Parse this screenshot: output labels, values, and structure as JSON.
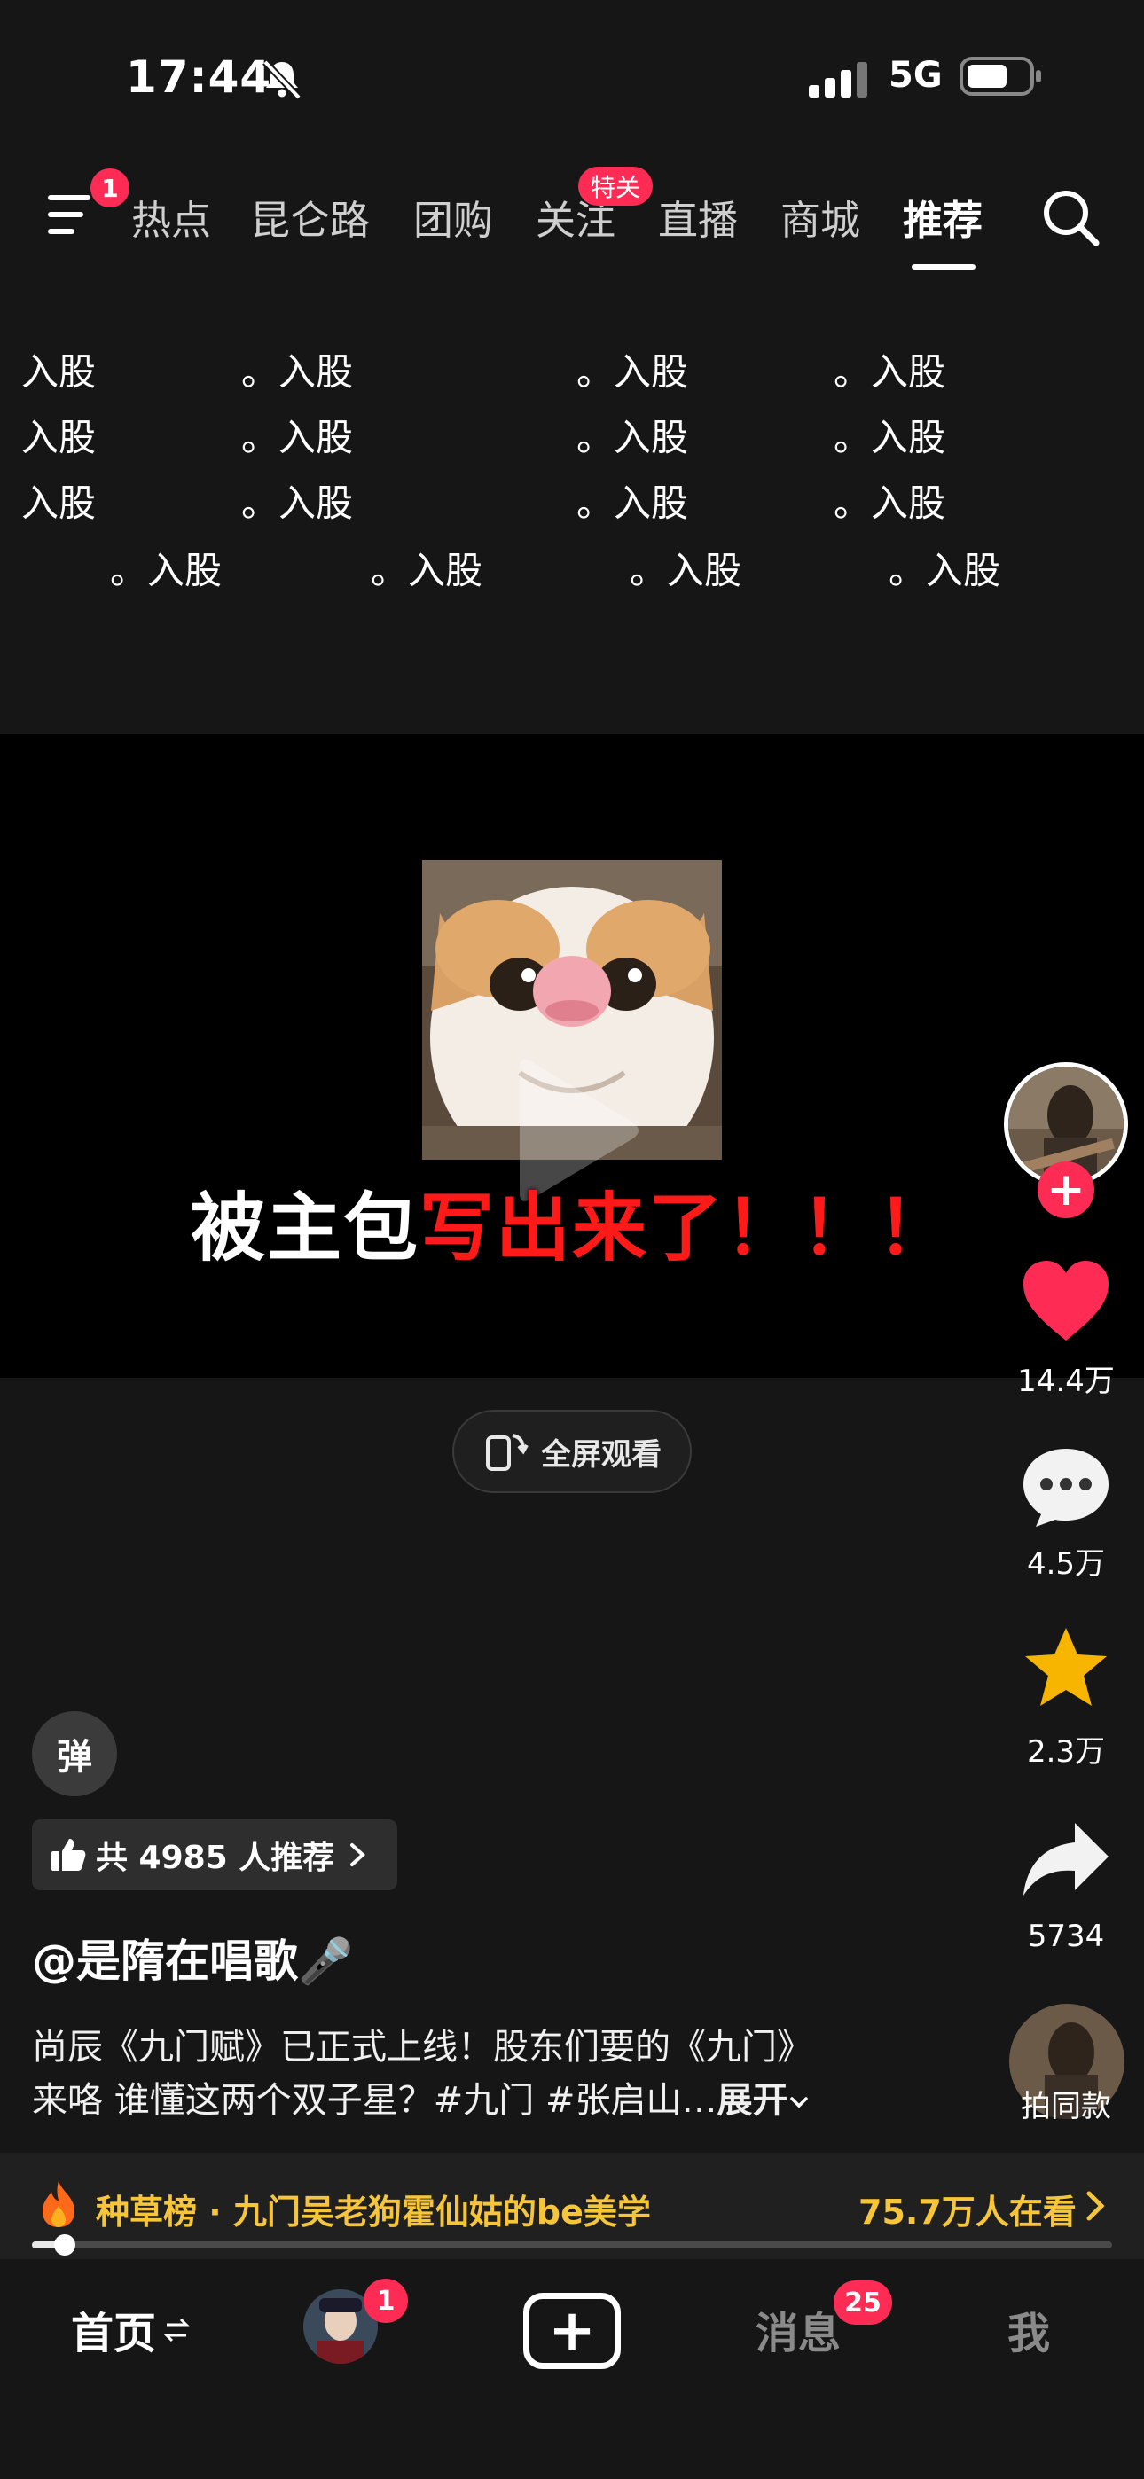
{
  "status_bar": {
    "time": "17:44",
    "network": "5G"
  },
  "top_nav": {
    "menu_badge": "1",
    "tabs": [
      {
        "label": "热点"
      },
      {
        "label": "昆仑路"
      },
      {
        "label": "团购"
      },
      {
        "label": "关注",
        "badge": "特关"
      },
      {
        "label": "直播"
      },
      {
        "label": "商城"
      },
      {
        "label": "推荐",
        "active": true
      }
    ]
  },
  "danmaku": {
    "text": "入股",
    "dotted_text": "。入股"
  },
  "video": {
    "caption_white": "被主包",
    "caption_red": "写出来了！！！",
    "fullscreen_label": "全屏观看"
  },
  "rail": {
    "likes": "14.4万",
    "comments": "4.5万",
    "favorites": "2.3万",
    "shares": "5734",
    "same_label": "拍同款"
  },
  "post": {
    "danmaku_toggle": "弹",
    "recommend_text": "共 4985 人推荐",
    "author": "@是隋在唱歌🎤",
    "desc_line1": "尚辰《九门赋》已正式上线！股东们要的《九门》",
    "desc_line2": "来咯 谁懂这两个双子星？#九门 #张启山…",
    "expand": "展开"
  },
  "ranking": {
    "text": "种草榜 · 九门吴老狗霍仙姑的be美学",
    "viewers": "75.7万人在看"
  },
  "playback": {
    "progress": 0.03
  },
  "bottom_nav": {
    "home": "首页",
    "friends_badge": "1",
    "messages": "消息",
    "messages_badge": "25",
    "me": "我"
  },
  "colors": {
    "accent": "#fe2c55",
    "gold": "#f7c53a",
    "caption_red": "#ff1a1a"
  }
}
